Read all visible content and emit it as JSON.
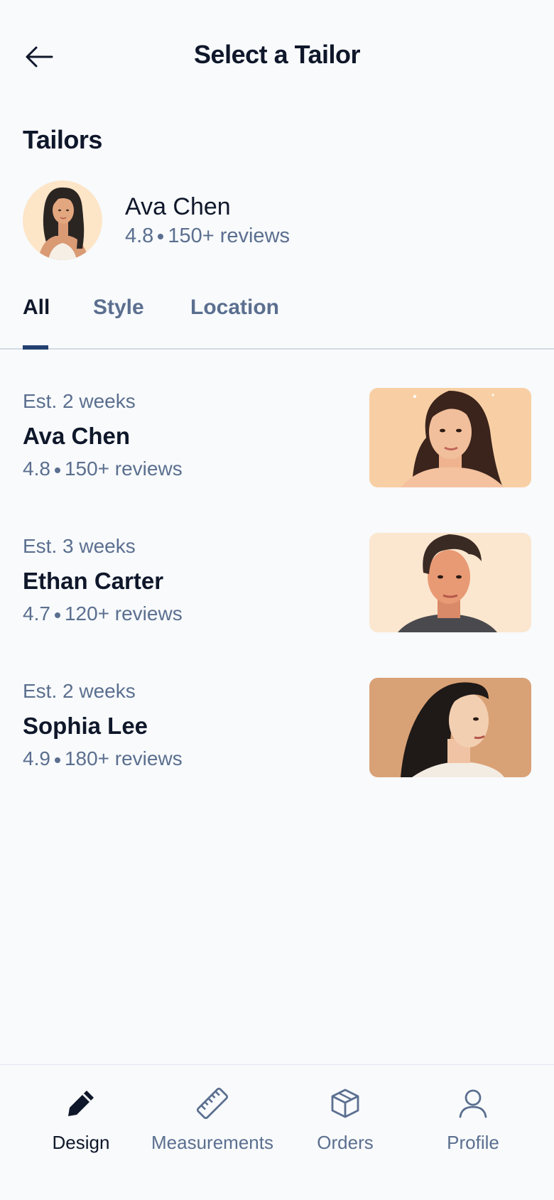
{
  "header": {
    "title": "Select a Tailor",
    "back_icon": "arrow-left-icon"
  },
  "section": {
    "title": "Tailors"
  },
  "featured": {
    "name": "Ava Chen",
    "rating": "4.8",
    "reviews": "150+ reviews"
  },
  "tabs": [
    {
      "label": "All",
      "active": true
    },
    {
      "label": "Style",
      "active": false
    },
    {
      "label": "Location",
      "active": false
    }
  ],
  "tailors": [
    {
      "estimate": "Est. 2 weeks",
      "name": "Ava Chen",
      "rating": "4.8",
      "reviews": "150+ reviews",
      "thumb_bg": "#f8cfa4"
    },
    {
      "estimate": "Est. 3 weeks",
      "name": "Ethan Carter",
      "rating": "4.7",
      "reviews": "120+ reviews",
      "thumb_bg": "#fbe7cf"
    },
    {
      "estimate": "Est. 2 weeks",
      "name": "Sophia Lee",
      "rating": "4.9",
      "reviews": "180+ reviews",
      "thumb_bg": "#d9a176"
    }
  ],
  "nav": [
    {
      "label": "Design",
      "icon": "pencil-icon",
      "active": true
    },
    {
      "label": "Measurements",
      "icon": "ruler-icon",
      "active": false
    },
    {
      "label": "Orders",
      "icon": "box-icon",
      "active": false
    },
    {
      "label": "Profile",
      "icon": "user-icon",
      "active": false
    }
  ],
  "colors": {
    "background": "#f8fafc",
    "text_primary": "#0f172a",
    "text_secondary": "#5b6f8f",
    "accent": "#234070"
  }
}
